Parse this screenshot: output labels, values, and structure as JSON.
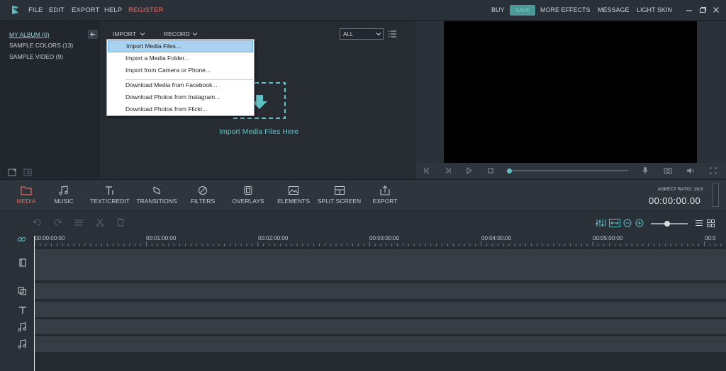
{
  "topbar": {
    "menu": [
      "FILE",
      "EDIT",
      "EXPORT",
      "HELP",
      "REGISTER"
    ],
    "right_menu": {
      "buy": "BUY",
      "save": "SAVE",
      "more_effects": "MORE EFFECTS",
      "message": "MESSAGE",
      "light_skin": "LIGHT SKIN"
    },
    "accent_register": "#e6695c"
  },
  "library": {
    "albums": [
      {
        "label": "MY ALBUM (0)",
        "active": true
      },
      {
        "label": "SAMPLE COLORS (13)",
        "active": false
      },
      {
        "label": "SAMPLE VIDEO (9)",
        "active": false
      }
    ]
  },
  "media": {
    "import_label": "IMPORT",
    "record_label": "RECORD",
    "filter_value": "ALL",
    "drop_caption": "Import Media Files Here",
    "dropdown": [
      {
        "label": "Import Media Files...",
        "selected": true
      },
      {
        "label": "Import a Media Folder...",
        "selected": false
      },
      {
        "label": "Import from Camera or Phone...",
        "selected": false
      },
      {
        "label": "Download Media from Facebook...",
        "selected": false
      },
      {
        "label": "Download Photos from Instagram...",
        "selected": false
      },
      {
        "label": "Download Photos from Flickr...",
        "selected": false
      }
    ]
  },
  "tools": [
    {
      "label": "MEDIA",
      "icon": "folder-icon",
      "active": true
    },
    {
      "label": "MUSIC",
      "icon": "music-icon",
      "active": false
    },
    {
      "label": "TEXT/CREDIT",
      "icon": "text-icon",
      "active": false
    },
    {
      "label": "TRANSITIONS",
      "icon": "transitions-icon",
      "active": false
    },
    {
      "label": "FILTERS",
      "icon": "filters-icon",
      "active": false
    },
    {
      "label": "OVERLAYS",
      "icon": "overlays-icon",
      "active": false
    },
    {
      "label": "ELEMENTS",
      "icon": "elements-icon",
      "active": false
    },
    {
      "label": "SPLIT SCREEN",
      "icon": "split-screen-icon",
      "active": false
    },
    {
      "label": "EXPORT",
      "icon": "export-icon",
      "active": false
    }
  ],
  "preview": {
    "aspect_ratio_label": "ASPECT RATIO: 16:9",
    "timecode": "00:00:00.00",
    "progress_fraction": 0.0
  },
  "timeline": {
    "ruler": [
      "00:00:00:00",
      "00:01:00:00",
      "00:02:00:00",
      "00:03:00:00",
      "00:04:00:00",
      "00:05:00:00",
      "00:0"
    ]
  },
  "colors": {
    "accent": "#5fc1c5",
    "active_tab": "#e6695c"
  }
}
